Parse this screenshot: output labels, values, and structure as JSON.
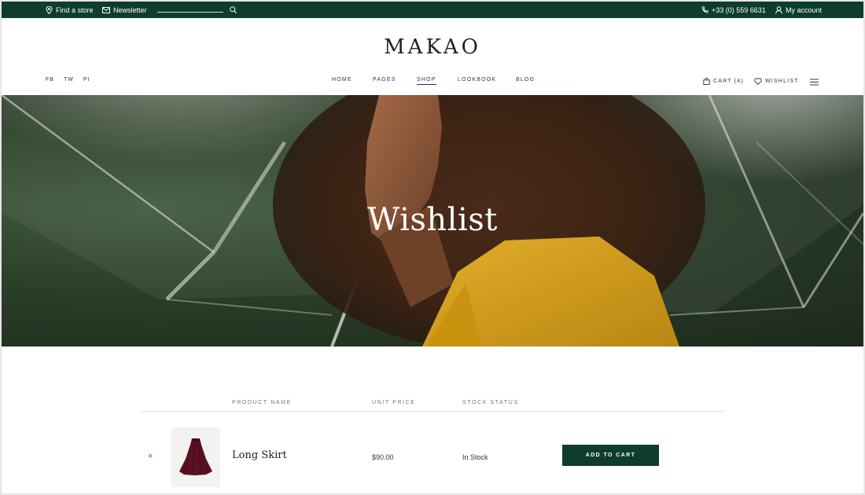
{
  "topbar": {
    "find_store": "Find a store",
    "newsletter": "Newsletter",
    "phone": "+33 (0) 559 6631",
    "account": "My account"
  },
  "header": {
    "logo": "MAKAO",
    "social": [
      "FB",
      "TW",
      "PI"
    ],
    "nav": [
      "HOME",
      "PAGES",
      "SHOP",
      "LOOKBOOK",
      "BLOG"
    ],
    "active_nav": "SHOP",
    "cart": "CART (4)",
    "wishlist": "WISHLIST"
  },
  "hero": {
    "title": "Wishlist"
  },
  "table": {
    "headers": [
      "PRODUCT NAME",
      "UNIT PRICE",
      "STOCK STATUS"
    ],
    "rows": [
      {
        "remove": "×",
        "name": "Long Skirt",
        "price": "$90.00",
        "stock": "In Stock",
        "action": "ADD TO CART"
      }
    ]
  },
  "colors": {
    "brand_green": "#0f3d2b",
    "coat_yellow": "#d6a11c"
  }
}
